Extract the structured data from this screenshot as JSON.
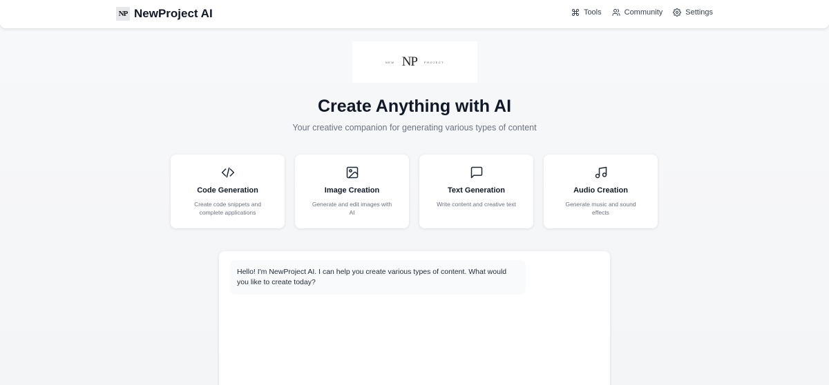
{
  "header": {
    "logo_mark": "NP",
    "title": "NewProject AI",
    "nav": [
      {
        "label": "Tools",
        "icon": "command-icon"
      },
      {
        "label": "Community",
        "icon": "users-icon"
      },
      {
        "label": "Settings",
        "icon": "gear-icon"
      }
    ]
  },
  "hero": {
    "logo": {
      "left": "NEW",
      "center": "NP",
      "right": "PROJECT"
    },
    "title": "Create Anything with AI",
    "subtitle": "Your creative companion for generating various types of content"
  },
  "cards": [
    {
      "title": "Code Generation",
      "description": "Create code snippets and complete applications",
      "icon": "code-icon"
    },
    {
      "title": "Image Creation",
      "description": "Generate and edit images with AI",
      "icon": "image-icon"
    },
    {
      "title": "Text Generation",
      "description": "Write content and creative text",
      "icon": "message-icon"
    },
    {
      "title": "Audio Creation",
      "description": "Generate music and sound effects",
      "icon": "music-icon"
    }
  ],
  "chat": {
    "messages": [
      {
        "role": "assistant",
        "text": "Hello! I'm NewProject AI. I can help you create various types of content. What would you like to create today?"
      }
    ]
  },
  "colors": {
    "background": "#f6f7f9",
    "text_primary": "#111827",
    "text_muted": "#6b7280"
  }
}
